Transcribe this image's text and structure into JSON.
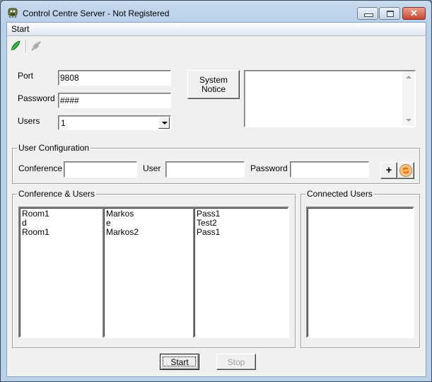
{
  "window": {
    "title": "Control Centre Server - Not Registered",
    "caption_buttons": {
      "minimize": "minimize",
      "maximize": "maximize",
      "close": "✕"
    }
  },
  "menu": {
    "items": [
      {
        "label": "Start"
      }
    ]
  },
  "toolbar": {
    "icons": [
      "connect-leaf-icon",
      "disconnect-plug-icon"
    ]
  },
  "server": {
    "port_label": "Port",
    "port_value": "9808",
    "password_label": "Password",
    "password_value": "####",
    "users_label": "Users",
    "users_value": "1",
    "system_notice_label_line1": "System",
    "system_notice_label_line2": "Notice",
    "notice_text": ""
  },
  "user_configuration": {
    "title": "User Configuration",
    "conference_label": "Conference",
    "conference_value": "",
    "user_label": "User",
    "user_value": "",
    "password_label": "Password",
    "password_value": "",
    "add_label": "+"
  },
  "conference_users": {
    "title": "Conference & Users",
    "conferences": [
      "Room1",
      "d",
      "Room1"
    ],
    "users": [
      "Markos",
      "e",
      "Markos2"
    ],
    "passwords": [
      "Pass1",
      "Test2",
      "Pass1"
    ]
  },
  "connected_users": {
    "title": "Connected Users",
    "items": []
  },
  "actions": {
    "start_label": "Start",
    "stop_label": "Stop"
  }
}
